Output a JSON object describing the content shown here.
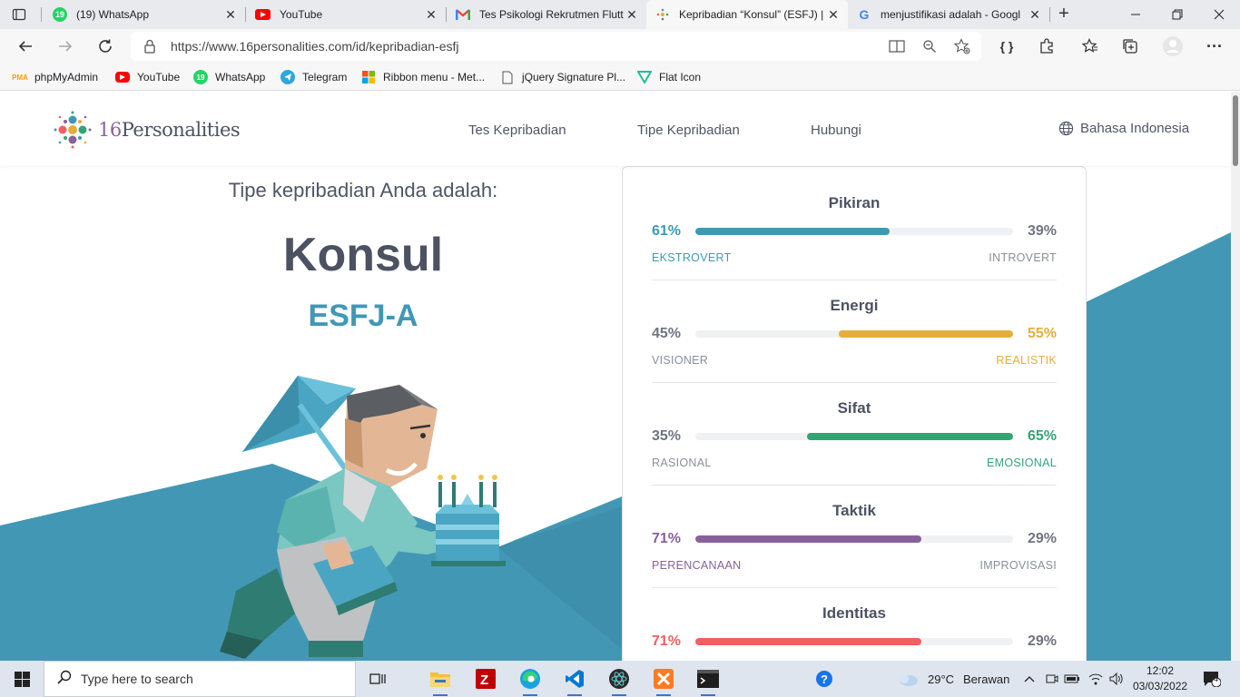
{
  "browser": {
    "tabs": [
      {
        "title": "(19) WhatsApp",
        "icon": "whatsapp-icon",
        "badge": "19"
      },
      {
        "title": "YouTube",
        "icon": "youtube-icon"
      },
      {
        "title": "Tes Psikologi Rekrutmen Flutt",
        "icon": "gmail-icon"
      },
      {
        "title": "Kepribadian “Konsul” (ESFJ) |",
        "icon": "16personalities-icon",
        "active": true
      },
      {
        "title": "menjustifikasi adalah - Googl",
        "icon": "google-icon"
      }
    ],
    "url": "https://www.16personalities.com/id/kepribadian-esfj",
    "bookmarks": [
      {
        "label": "phpMyAdmin",
        "icon": "phpmyadmin-icon"
      },
      {
        "label": "YouTube",
        "icon": "youtube-icon"
      },
      {
        "label": "WhatsApp",
        "icon": "whatsapp-icon"
      },
      {
        "label": "Telegram",
        "icon": "telegram-icon"
      },
      {
        "label": "Ribbon menu - Met...",
        "icon": "microsoft-icon"
      },
      {
        "label": "jQuery Signature Pl...",
        "icon": "page-icon"
      },
      {
        "label": "Flat Icon",
        "icon": "flaticon-icon"
      }
    ]
  },
  "site": {
    "logo_number": "16",
    "logo_word": "Personalities",
    "nav": [
      "Tes Kepribadian",
      "Tipe Kepribadian",
      "Hubungi"
    ],
    "language": "Bahasa Indonesia"
  },
  "result": {
    "intro": "Tipe kepribadian Anda adalah:",
    "name": "Konsul",
    "code": "ESFJ-A"
  },
  "traits": [
    {
      "title": "Pikiran",
      "left_pct": "61%",
      "right_pct": "39%",
      "left_label": "EKSTROVERT",
      "right_label": "INTROVERT",
      "value": 0.61,
      "side": "left",
      "color": "#4298b4"
    },
    {
      "title": "Energi",
      "left_pct": "45%",
      "right_pct": "55%",
      "left_label": "VISIONER",
      "right_label": "REALISTIK",
      "value": 0.55,
      "side": "right",
      "color": "#e4ae3a"
    },
    {
      "title": "Sifat",
      "left_pct": "35%",
      "right_pct": "65%",
      "left_label": "RASIONAL",
      "right_label": "EMOSIONAL",
      "value": 0.65,
      "side": "right",
      "color": "#33a474"
    },
    {
      "title": "Taktik",
      "left_pct": "71%",
      "right_pct": "29%",
      "left_label": "PERENCANAAN",
      "right_label": "IMPROVISASI",
      "value": 0.71,
      "side": "left",
      "color": "#88619a"
    },
    {
      "title": "Identitas",
      "left_pct": "71%",
      "right_pct": "29%",
      "left_label": "",
      "right_label": "",
      "value": 0.71,
      "side": "left",
      "color": "#f25e62"
    }
  ],
  "taskbar": {
    "search_placeholder": "Type here to search",
    "weather_temp": "29°C",
    "weather_text": "Berawan",
    "time": "12:02",
    "date": "03/03/2022",
    "notifications": "4"
  }
}
